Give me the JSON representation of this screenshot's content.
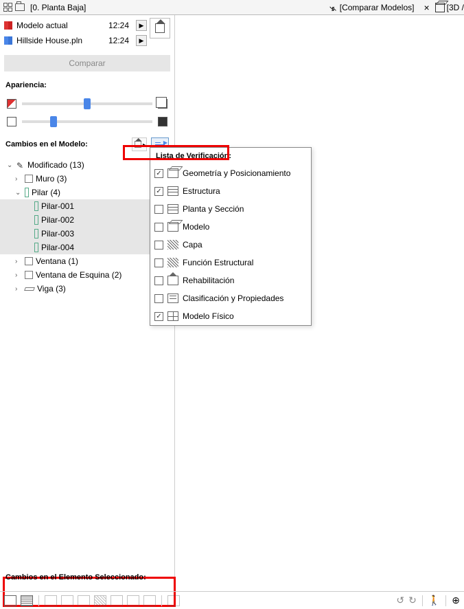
{
  "tabs": {
    "plan": "[0. Planta Baja]",
    "compare": "[Comparar Modelos]",
    "view3d": "[3D /"
  },
  "models": {
    "current": {
      "name": "Modelo actual",
      "time": "12:24"
    },
    "other": {
      "name": "Hillside House.pln",
      "time": "12:24"
    }
  },
  "compare_button": "Comparar",
  "appearance_label": "Apariencia:",
  "slider": {
    "pos1": 50,
    "pos2": 24
  },
  "changes_label": "Cambios en el Modelo:",
  "popup_title": "Lista de Verificación:",
  "checklist": [
    {
      "label": "Geometría y Posicionamiento",
      "checked": true,
      "icon": "box3d"
    },
    {
      "label": "Estructura",
      "checked": true,
      "icon": "layers"
    },
    {
      "label": "Planta y Sección",
      "checked": false,
      "icon": "layers"
    },
    {
      "label": "Modelo",
      "checked": false,
      "icon": "box3d"
    },
    {
      "label": "Capa",
      "checked": false,
      "icon": "diag"
    },
    {
      "label": "Función Estructural",
      "checked": false,
      "icon": "diag"
    },
    {
      "label": "Rehabilitación",
      "checked": false,
      "icon": "house"
    },
    {
      "label": "Clasificación y Propiedades",
      "checked": false,
      "icon": "lines"
    },
    {
      "label": "Modelo Físico",
      "checked": true,
      "icon": "grid"
    }
  ],
  "tree": {
    "modified": "Modificado (13)",
    "items": [
      {
        "label": "Muro (3)",
        "expanded": false
      },
      {
        "label": "Pilar (4)",
        "expanded": true,
        "children": [
          "Pilar-001",
          "Pilar-002",
          "Pilar-003",
          "Pilar-004"
        ]
      },
      {
        "label": "Ventana (1)",
        "expanded": false
      },
      {
        "label": "Ventana de Esquina (2)",
        "expanded": false
      },
      {
        "label": "Viga (3)",
        "expanded": false
      }
    ]
  },
  "bottom_label": "Cambios en el Elemento Seleccionado:"
}
